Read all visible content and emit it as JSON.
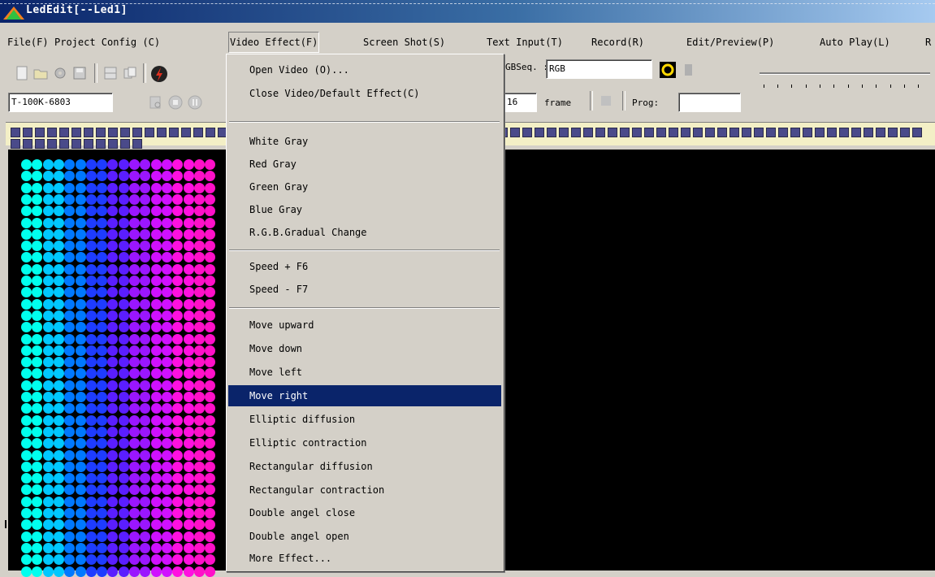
{
  "window": {
    "title": "LedEdit[--Led1]"
  },
  "menubar": {
    "items": [
      {
        "label": "File(F)"
      },
      {
        "label": "Project Config (C)"
      },
      {
        "label": "Video Effect(F)"
      },
      {
        "label": "Screen Shot(S)"
      },
      {
        "label": "Text Input(T)"
      },
      {
        "label": "Record(R)"
      },
      {
        "label": "Edit/Preview(P)"
      },
      {
        "label": "Auto Play(L)"
      },
      {
        "label": "R"
      }
    ],
    "active_index": 2
  },
  "toolbar": {
    "rgb_seq_label": "GBSeq. :",
    "rgb_seq_value": "RGB",
    "device_value": "T-100K-6803",
    "frame_value": "16",
    "frame_label": "frame",
    "prog_label": "Prog:",
    "prog_value": ""
  },
  "dropdown": {
    "groups": [
      [
        "Open Video (O)...",
        "Close Video/Default Effect(C)"
      ],
      [],
      [
        "White Gray",
        "Red Gray",
        "Green Gray",
        "Blue Gray",
        "R.G.B.Gradual Change"
      ],
      [
        "Speed +  F6",
        "Speed -  F7"
      ],
      [
        "Move upward",
        "Move down",
        "Move left",
        "Move right",
        "Elliptic diffusion",
        "Elliptic contraction",
        "Rectangular diffusion",
        "Rectangular contraction",
        "Double angel close",
        "Double angel open",
        "More Effect..."
      ]
    ],
    "selected": "Move right"
  },
  "led_palette": [
    "#00ffee",
    "#00c8ff",
    "#0078ff",
    "#1e3cff",
    "#5a1eff",
    "#9a16ff",
    "#d010ff",
    "#ff10e0",
    "#ff10c8"
  ],
  "colors": {
    "menu_highlight": "#0a246a",
    "canvas": "#000000",
    "ruler": "#f3efc6"
  }
}
